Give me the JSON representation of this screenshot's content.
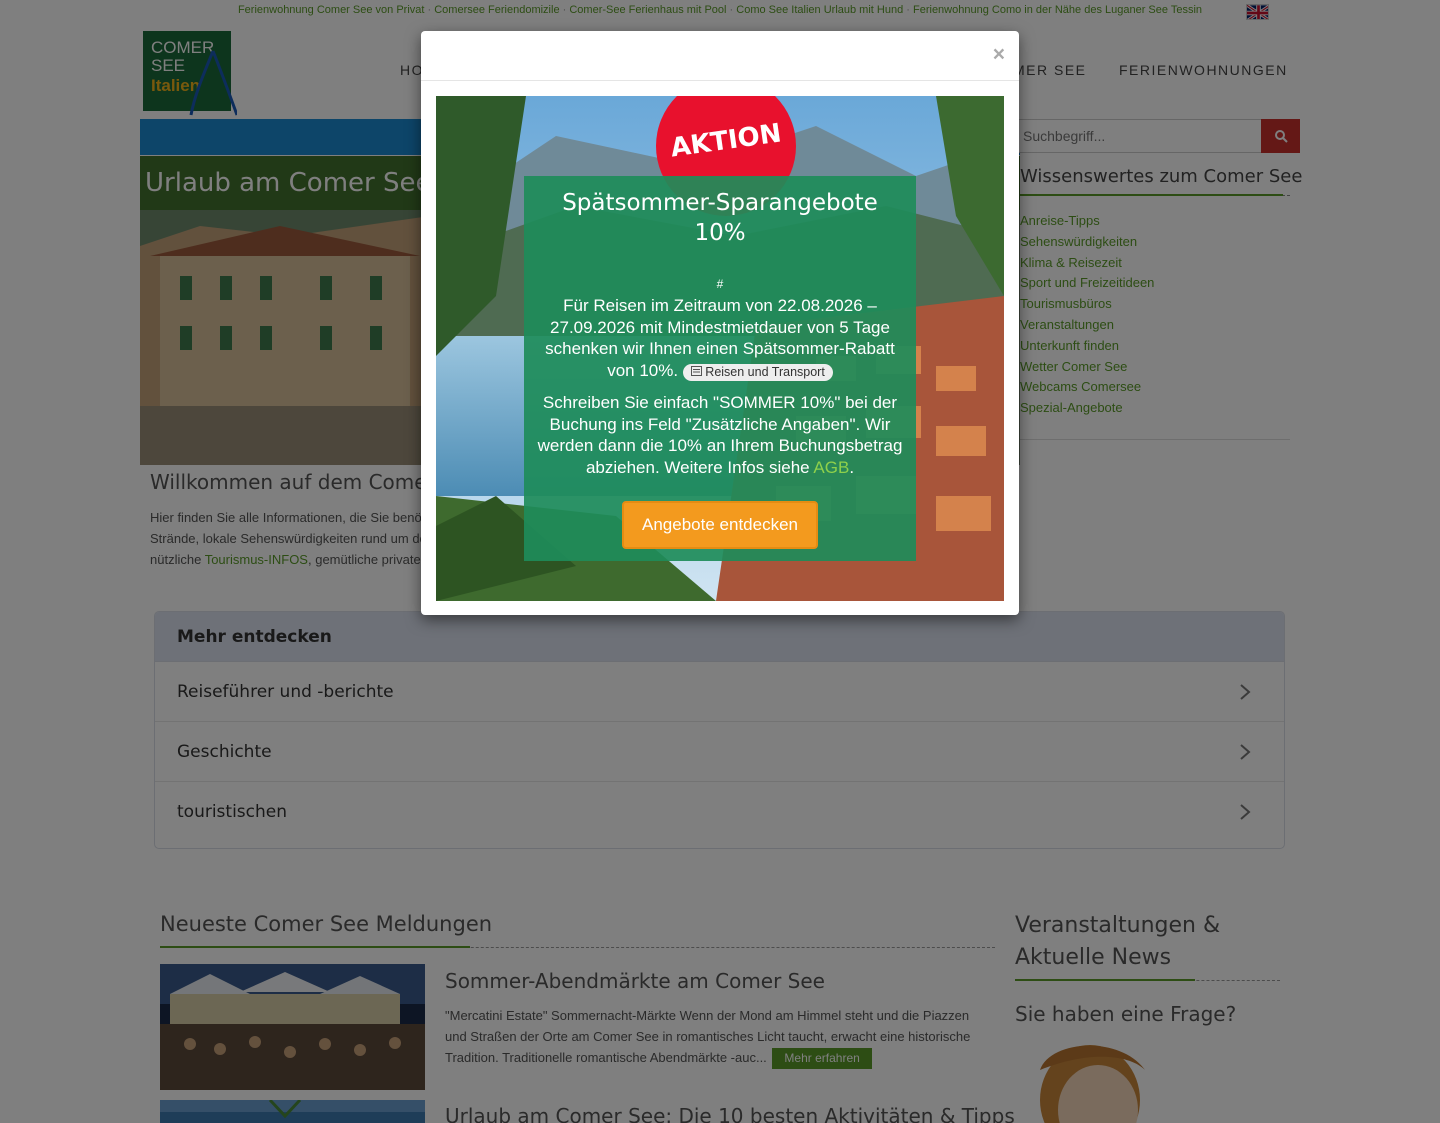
{
  "top_links": [
    "Ferienwohnung Comer See von Privat",
    "Comersee Feriendomizile",
    "Comer-See Ferienhaus mit Pool",
    "Como See Italien Urlaub mit Hund",
    "Ferienwohnung Como in der Nähe des Luganer See Tessin"
  ],
  "top_links_separator": "·",
  "logo": {
    "line1": "COMER",
    "line2": "SEE",
    "line3": "Italien"
  },
  "nav": {
    "home": "HO",
    "see": "MER SEE",
    "apartments": "FERIENWOHNUNGEN"
  },
  "search": {
    "placeholder": "Suchbegriff..."
  },
  "hero": {
    "title": "Urlaub am Comer See"
  },
  "welcome": {
    "title": "Willkommen auf dem Comer",
    "line1": "Hier finden Sie alle Informationen, die Sie benö",
    "line2": "Strände, lokale Sehenswürdigkeiten rund um de",
    "line3_before": "nützliche ",
    "line3_link": "Tourismus-INFOS",
    "line3_after": ", gemütliche private"
  },
  "sidebar": {
    "title": "Wissenswertes zum Comer See",
    "items": [
      "Anreise-Tipps",
      "Sehenswürdigkeiten",
      "Klima & Reisezeit",
      "Sport und Freizeitideen",
      "Tourismusbüros",
      "Veranstaltungen",
      "Unterkunft finden",
      "Wetter Comer See",
      "Webcams Comersee",
      "Spezial-Angebote"
    ]
  },
  "accordion": {
    "title": "Mehr entdecken",
    "items": [
      "Reiseführer und -berichte",
      "Geschichte",
      "touristischen"
    ]
  },
  "news": {
    "title": "Neueste Comer See Meldungen",
    "articles": [
      {
        "title": "Sommer-Abendmärkte am Comer See",
        "text": "\"Mercatini Estate\"  Sommernacht-Märkte Wenn der Mond am Himmel steht und die Piazzen und Straßen der Orte am Comer See in romantisches Licht taucht, erwacht eine historische Tradition. Traditionelle romantische Abendmärkte -auc...",
        "button": "Mehr erfahren"
      },
      {
        "title": "Urlaub am Comer See: Die 10 besten Aktivitäten & Tipps"
      }
    ]
  },
  "events": {
    "title": "Veranstaltungen & Aktuelle News"
  },
  "question": {
    "title": "Sie haben eine Frage?"
  },
  "modal": {
    "close": "×",
    "badge": "AKTION",
    "title": "Spätsommer-Sparangebote 10%",
    "hash": "#",
    "p1": "Für Reisen im Zeitraum von 22.08.2026 – 27.09.2026 mit Mindestmietdauer von 5 Tage schenken wir Ihnen einen Spätsommer-Rabatt von 10%.",
    "tag": "Reisen und Transport",
    "p2_before": "Schreiben Sie einfach \"SOMMER 10%\" bei der Buchung ins Feld \"Zusätzliche Angaben\". Wir werden dann die 10% an Ihrem Buchungsbetrag abziehen. Weitere Infos siehe ",
    "p2_link": "AGB",
    "p2_after": ".",
    "button": "Angebote entdecken"
  },
  "colors": {
    "green": "#5a9b28",
    "blue_bar": "#1a8ad2",
    "search_button": "#c9302c",
    "badge_red": "#e8112d",
    "promo_box": "#1e8c5a",
    "promo_button": "#f39a1e"
  }
}
